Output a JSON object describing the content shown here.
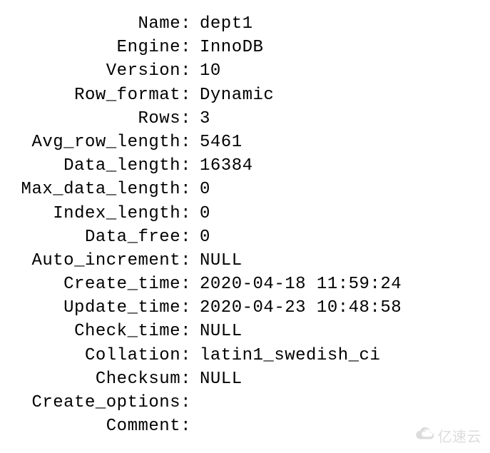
{
  "status": {
    "fields": [
      {
        "label": "Name",
        "value": "dept1"
      },
      {
        "label": "Engine",
        "value": "InnoDB"
      },
      {
        "label": "Version",
        "value": "10"
      },
      {
        "label": "Row_format",
        "value": "Dynamic"
      },
      {
        "label": "Rows",
        "value": "3"
      },
      {
        "label": "Avg_row_length",
        "value": "5461"
      },
      {
        "label": "Data_length",
        "value": "16384"
      },
      {
        "label": "Max_data_length",
        "value": "0"
      },
      {
        "label": "Index_length",
        "value": "0"
      },
      {
        "label": "Data_free",
        "value": "0"
      },
      {
        "label": "Auto_increment",
        "value": "NULL"
      },
      {
        "label": "Create_time",
        "value": "2020-04-18 11:59:24"
      },
      {
        "label": "Update_time",
        "value": "2020-04-23 10:48:58"
      },
      {
        "label": "Check_time",
        "value": "NULL"
      },
      {
        "label": "Collation",
        "value": "latin1_swedish_ci"
      },
      {
        "label": "Checksum",
        "value": "NULL"
      },
      {
        "label": "Create_options",
        "value": ""
      },
      {
        "label": "Comment",
        "value": ""
      }
    ]
  },
  "watermark": {
    "text": "亿速云"
  }
}
